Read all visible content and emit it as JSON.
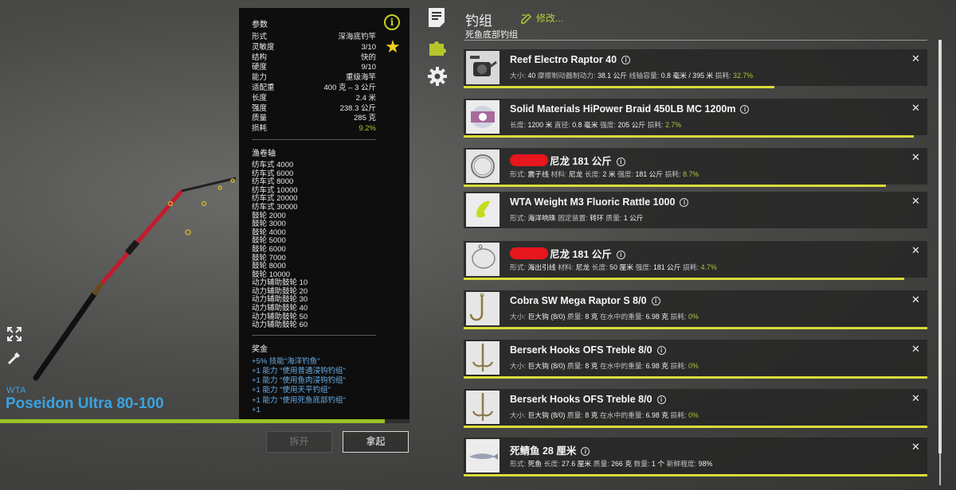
{
  "rod": {
    "brand": "WTA",
    "name": "Poseidon Ultra 80-100",
    "progress_fraction": 0.94
  },
  "params": {
    "title": "参数",
    "rows": [
      {
        "label": "形式",
        "value": "深海底钓竿"
      },
      {
        "label": "灵敏度",
        "value": "3/10"
      },
      {
        "label": "结构",
        "value": "快的"
      },
      {
        "label": "硬度",
        "value": "9/10"
      },
      {
        "label": "能力",
        "value": "重级海竿"
      },
      {
        "label": "适配重",
        "value": "400 克 – 3 公斤"
      },
      {
        "label": "长度",
        "value": "2.4 米"
      },
      {
        "label": "强度",
        "value": "238.3 公斤"
      },
      {
        "label": "质量",
        "value": "285 克"
      },
      {
        "label": "损耗",
        "value": "9.2%"
      }
    ]
  },
  "reels": {
    "title": "渔卷轴",
    "items": [
      "纺车式 4000",
      "纺车式 6000",
      "纺车式 8000",
      "纺车式 10000",
      "纺车式 20000",
      "纺车式 30000",
      "鼓轮 2000",
      "鼓轮 3000",
      "鼓轮 4000",
      "鼓轮 5000",
      "鼓轮 6000",
      "鼓轮 7000",
      "鼓轮 8000",
      "鼓轮 10000",
      "动力辅助鼓轮 10",
      "动力辅助鼓轮 20",
      "动力辅助鼓轮 30",
      "动力辅助鼓轮 40",
      "动力辅助鼓轮 50",
      "动力辅助鼓轮 60"
    ]
  },
  "bonus": {
    "title": "奖金",
    "items": [
      "+5% 技能\"海洋钓鱼\"",
      "+1 能力 \"使用普通浸钩钓组\"",
      "+1 能力 \"使用鱼肉浸钩钓组\"",
      "+1 能力 \"使用天平钓组\"",
      "+1 能力 \"使用死鱼底部钓组\"",
      "+1"
    ]
  },
  "buttons": {
    "disassemble": "拆开",
    "pickup": "拿起"
  },
  "icons": {
    "info": "info-icon",
    "favorite": "star-icon",
    "expand": "expand-icon",
    "edit": "pen-icon",
    "notes": "document-icon",
    "puzzle": "puzzle-icon",
    "settings": "gear-icon"
  },
  "rig": {
    "title": "钓组",
    "edit_label": "修改...",
    "subtitle": "死鱼底部钓组",
    "items": [
      {
        "name": "Reef Electro Raptor 40",
        "redacted": false,
        "desc": [
          [
            "大小: ",
            "40"
          ],
          [
            " 摩擦制动器制动力: ",
            "38.1 公斤"
          ],
          [
            " 线轴容量: ",
            "0.8 毫米 / 395 米"
          ]
        ],
        "wear_label": " 损耗: ",
        "wear": "32.7%",
        "bar_fraction": 0.67,
        "thumb": "reel"
      },
      {
        "name": "Solid Materials HiPower Braid 450LB MC 1200m",
        "redacted": false,
        "desc": [
          [
            "长度: ",
            "1200 米"
          ],
          [
            " 直径: ",
            "0.8 毫米"
          ],
          [
            " 强度: ",
            "205 公斤"
          ]
        ],
        "wear_label": " 损耗: ",
        "wear": "2.7%",
        "bar_fraction": 0.97,
        "thumb": "spool"
      },
      {
        "name": "尼龙 181 公斤",
        "redacted": true,
        "desc": [
          [
            "形式: ",
            "震子线"
          ],
          [
            " 材料: ",
            "尼龙"
          ],
          [
            " 长度: ",
            "2 米"
          ],
          [
            " 强度: ",
            "181 公斤"
          ]
        ],
        "wear_label": " 损耗: ",
        "wear": "8.7%",
        "bar_fraction": 0.91,
        "thumb": "coil"
      },
      {
        "name": "WTA Weight M3 Fluoric Rattle 1000",
        "redacted": false,
        "desc": [
          [
            "形式: ",
            "海洋响珠"
          ],
          [
            " 固定装置: ",
            "转环"
          ],
          [
            " 质量: ",
            "1 公斤"
          ]
        ],
        "wear_label": "",
        "wear": "",
        "bar_fraction": 0,
        "thumb": "weight"
      },
      {
        "name": "尼龙 181 公斤",
        "redacted": true,
        "desc": [
          [
            "形式: ",
            "海出引线"
          ],
          [
            " 材料: ",
            "尼龙"
          ],
          [
            " 长度: ",
            "50 厘米"
          ],
          [
            " 强度: ",
            "181 公斤"
          ]
        ],
        "wear_label": " 损耗: ",
        "wear": "4.7%",
        "bar_fraction": 0.95,
        "thumb": "leader"
      },
      {
        "name": "Cobra SW Mega Raptor S 8/0",
        "redacted": false,
        "desc": [
          [
            "大小: ",
            "巨大钩 (8/0)"
          ],
          [
            " 质量: ",
            "8 克"
          ],
          [
            " 在水中的重量: ",
            "6.98 克"
          ]
        ],
        "wear_label": " 损耗: ",
        "wear": "0%",
        "bar_fraction": 1.0,
        "thumb": "hook"
      },
      {
        "name": "Berserk Hooks OFS Treble 8/0",
        "redacted": false,
        "desc": [
          [
            "大小: ",
            "巨大钩 (8/0)"
          ],
          [
            " 质量: ",
            "8 克"
          ],
          [
            " 在水中的重量: ",
            "6.98 克"
          ]
        ],
        "wear_label": " 损耗: ",
        "wear": "0%",
        "bar_fraction": 1.0,
        "thumb": "treble"
      },
      {
        "name": "Berserk Hooks OFS Treble 8/0",
        "redacted": false,
        "desc": [
          [
            "大小: ",
            "巨大钩 (8/0)"
          ],
          [
            " 质量: ",
            "8 克"
          ],
          [
            " 在水中的重量: ",
            "6.98 克"
          ]
        ],
        "wear_label": " 损耗: ",
        "wear": "0%",
        "bar_fraction": 1.0,
        "thumb": "treble"
      },
      {
        "name": "死鲭鱼 28 厘米",
        "redacted": false,
        "desc": [
          [
            "形式: ",
            "死鱼"
          ],
          [
            " 长度: ",
            "27.6 厘米"
          ],
          [
            " 质量: ",
            "266 克"
          ],
          [
            " 数量: ",
            "1 个"
          ],
          [
            " 新鲜程度: ",
            "98%"
          ]
        ],
        "wear_label": "",
        "wear": "",
        "bar_fraction": 1.0,
        "thumb": "fish"
      }
    ]
  }
}
